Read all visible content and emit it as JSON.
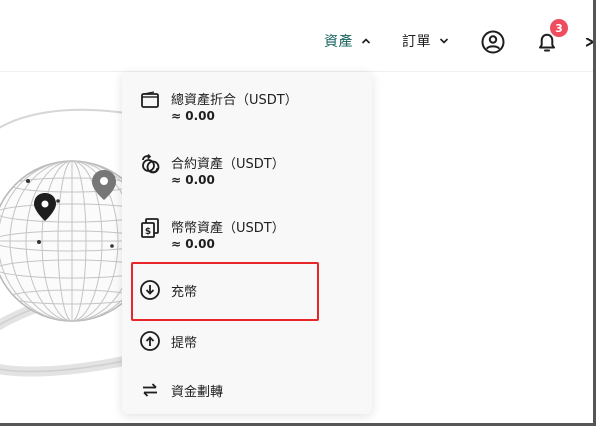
{
  "header": {
    "nav_assets": "資產",
    "nav_orders": "訂單",
    "notification_count": "3"
  },
  "menu": {
    "items": [
      {
        "icon": "wallet-icon",
        "title": "總資產折合（USDT）",
        "value": "≈ 0.00"
      },
      {
        "icon": "contract-assets-icon",
        "title": "合約資產（USDT）",
        "value": "≈ 0.00"
      },
      {
        "icon": "coin-assets-icon",
        "title": "幣幣資產（USDT）",
        "value": "≈ 0.00"
      },
      {
        "icon": "deposit-icon",
        "title": "充幣"
      },
      {
        "icon": "withdraw-icon",
        "title": "提幣"
      },
      {
        "icon": "transfer-icon",
        "title": "資金劃轉"
      }
    ]
  },
  "colors": {
    "accent": "#16625c",
    "badge": "#ee4d5f",
    "highlight_border": "#e8262a",
    "menu_bg": "#f8f8f8"
  }
}
